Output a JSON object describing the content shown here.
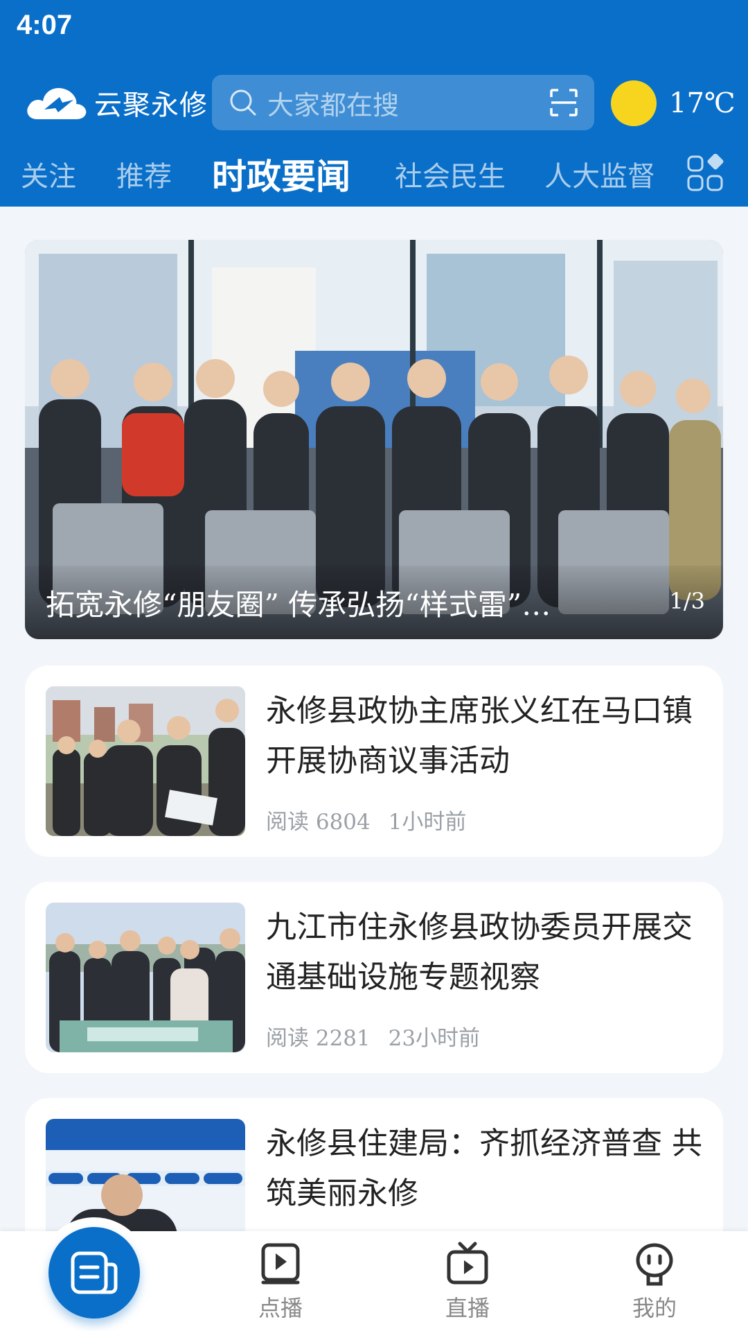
{
  "status": {
    "time": "4:07"
  },
  "header": {
    "app_name": "云聚永修",
    "search_placeholder": "大家都在搜",
    "weather_temp": "17℃",
    "colors": {
      "brand": "#0a6fc9",
      "sun": "#f7d51f"
    }
  },
  "tabs": [
    {
      "label": "关注"
    },
    {
      "label": "推荐"
    },
    {
      "label": "时政要闻",
      "active": true
    },
    {
      "label": "社会民生"
    },
    {
      "label": "人大监督"
    }
  ],
  "hero": {
    "title": "拓宽永修“朋友圈” 传承弘扬“样式雷”…",
    "pager": "1/3"
  },
  "news": [
    {
      "title": "永修县政协主席张义红在马口镇开展协商议事活动",
      "reads": "阅读 6804",
      "time": "1小时前"
    },
    {
      "title": "九江市住永修县政协委员开展交通基础设施专题视察",
      "reads": "阅读 2281",
      "time": "23小时前"
    },
    {
      "title": "永修县住建局：齐抓经济普查 共筑美丽永修"
    }
  ],
  "bottom_nav": [
    {
      "label": "",
      "icon": "news-icon",
      "active": true
    },
    {
      "label": "点播",
      "icon": "video-on-demand-icon"
    },
    {
      "label": "直播",
      "icon": "live-tv-icon"
    },
    {
      "label": "我的",
      "icon": "profile-icon"
    }
  ]
}
